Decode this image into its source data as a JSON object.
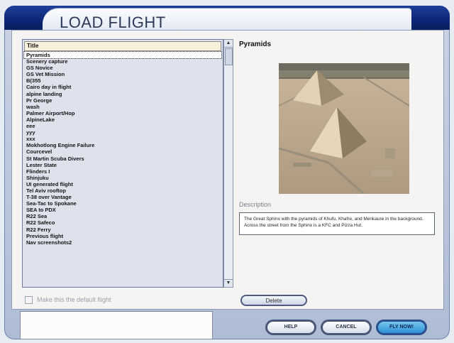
{
  "dialog": {
    "title": "LOAD FLIGHT"
  },
  "list": {
    "header": "Title",
    "selected_index": 0,
    "items": [
      "Pyramids",
      "Scenery capture",
      "GS Novice",
      "GS Vet Mission",
      "B(355",
      "Cairo day in flight",
      "alpine landing",
      "Pr George",
      "wash",
      "Palmer Airport/Hop",
      "AlpineLake",
      "eee",
      "yyy",
      "xxx",
      "Mokhotlong Engine Failure",
      "Courcevel",
      "St Martin Scuba Divers",
      "Lester State",
      "Flinders I",
      "Shinjuku",
      "UI generated flight",
      "Tel Aviv rooftop",
      "T-38 over Vantage",
      "Sea-Tac to Spokane",
      "SEA to PDX",
      "R22 Sea",
      "R22 Safeco",
      "R22 Ferry",
      "Previous flight",
      "Nav screenshots2"
    ]
  },
  "default_flight_label": "Make this the default flight",
  "details": {
    "title": "Pyramids",
    "description_label": "Description",
    "description": "The Great Sphinx with the pyramids of Khufu, Khafre, and Menkaure in the background. Across the street from the Sphinx is a KFC and Pizza Hut."
  },
  "buttons": {
    "delete": "Delete",
    "help": "HELP",
    "cancel": "CANCEL",
    "fly_now": "FLY NOW!"
  },
  "icons": {
    "scroll_up": "scroll-up-arrow-icon",
    "scroll_down": "scroll-down-arrow-icon"
  },
  "colors": {
    "titlebar": "#0c2676",
    "accent_button": "#2e8fd3"
  }
}
